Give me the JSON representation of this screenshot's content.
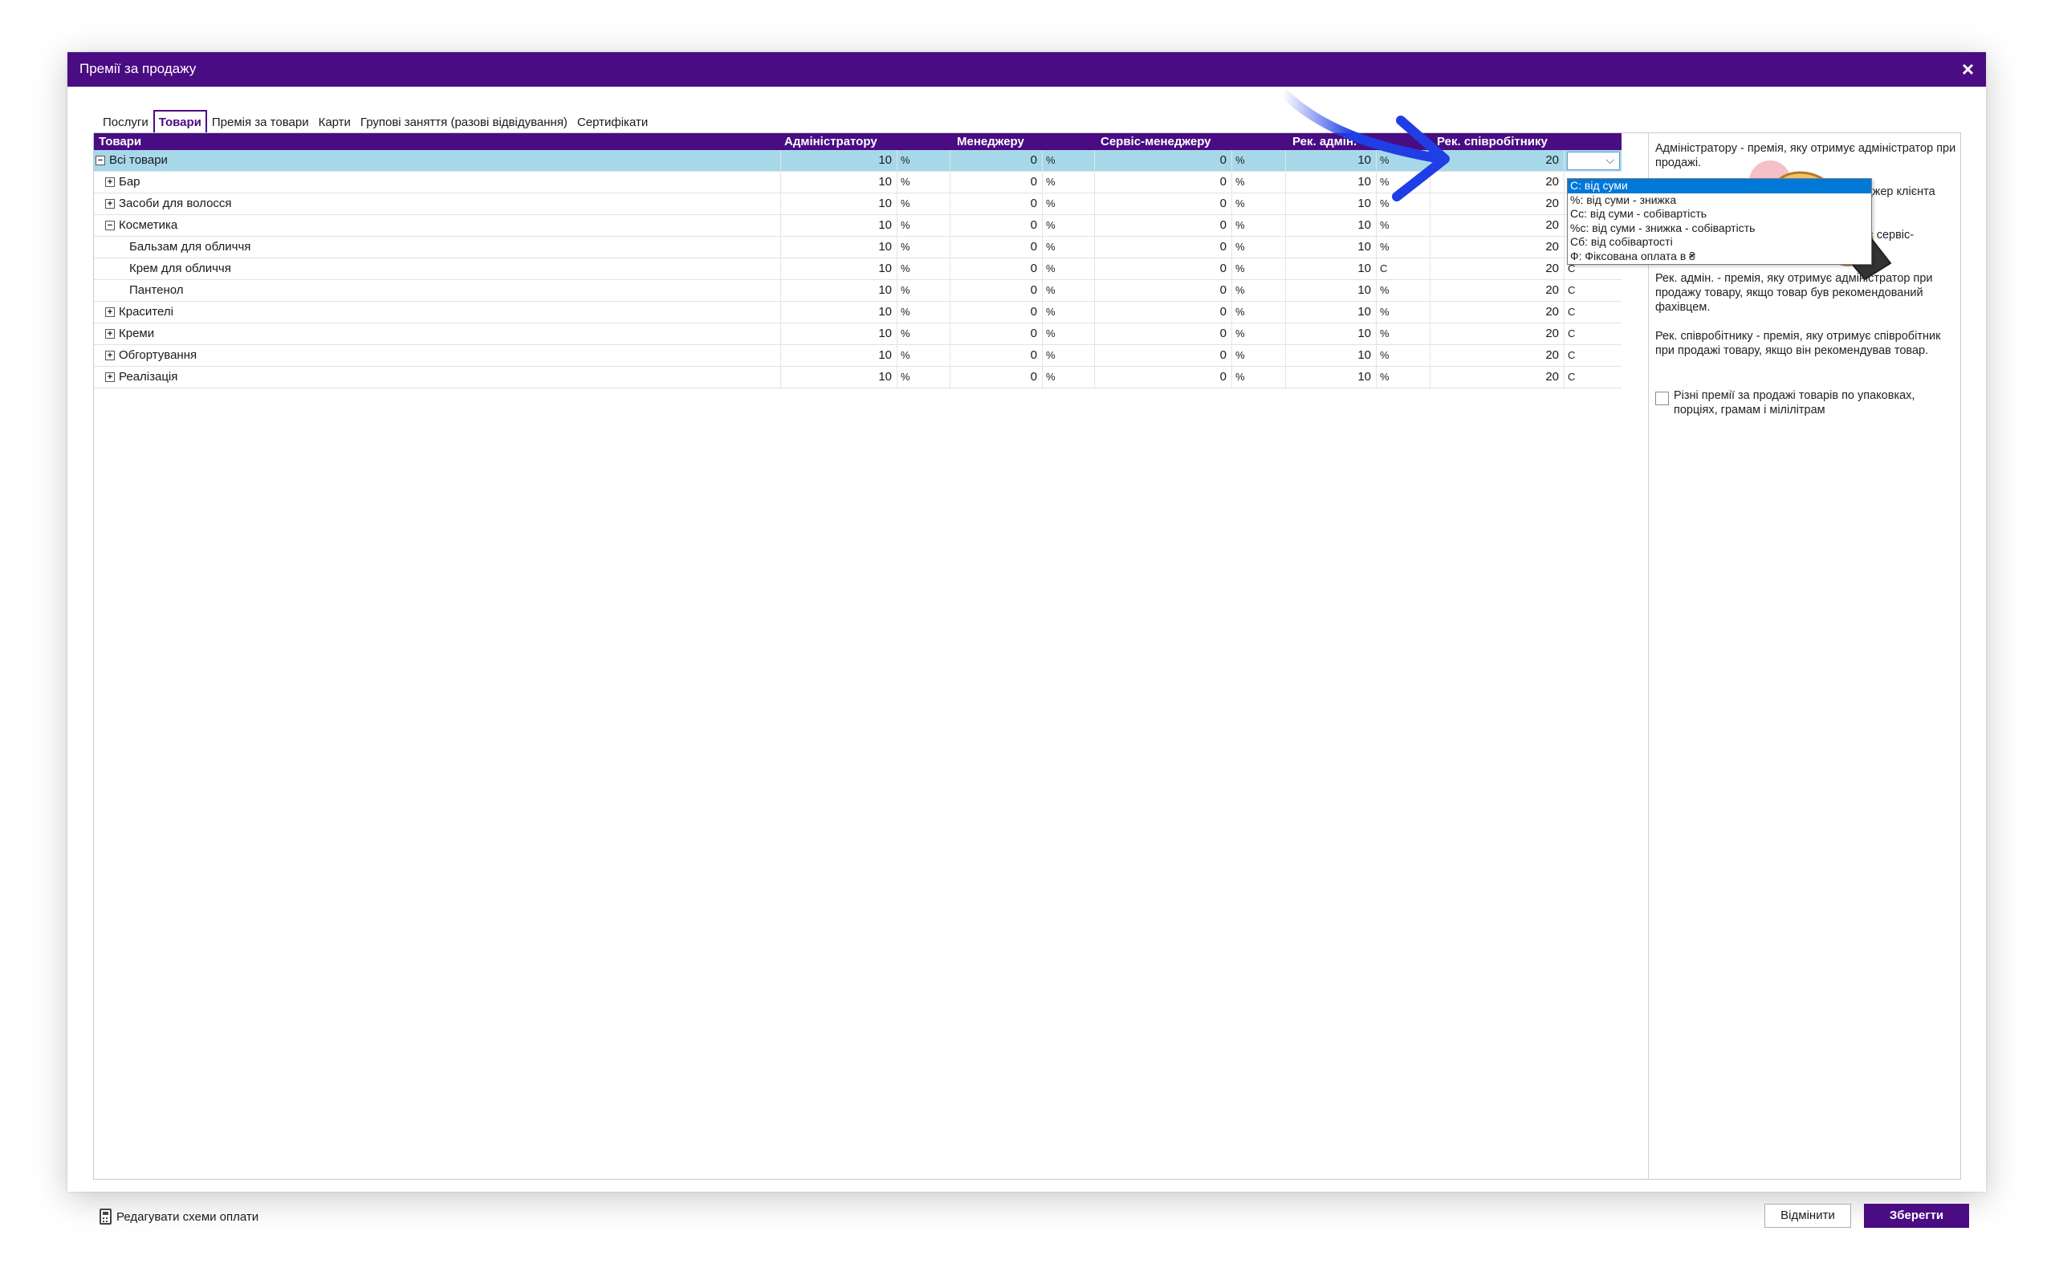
{
  "window": {
    "title": "Премії за продажу",
    "close_label": "×"
  },
  "tabs": [
    {
      "label": "Послуги",
      "active": false
    },
    {
      "label": "Товари",
      "active": true
    },
    {
      "label": "Премія за товари",
      "active": false
    },
    {
      "label": "Карти",
      "active": false
    },
    {
      "label": "Групові заняття (разові відвідування)",
      "active": false
    },
    {
      "label": "Сертифікати",
      "active": false
    }
  ],
  "grid": {
    "headers": {
      "name": "Товари",
      "admin": "Адміністратору",
      "manager": "Менеджеру",
      "service_manager": "Сервіс-менеджеру",
      "rec_admin": "Рек. адмін.",
      "rec_employee": "Рек. співробітнику"
    },
    "rows": [
      {
        "name": "Всі товари",
        "expander": "⊟",
        "admin": "10",
        "admin_u": "%",
        "manager": "0",
        "manager_u": "%",
        "service": "0",
        "service_u": "%",
        "rec_admin": "10",
        "rec_admin_u": "%",
        "rec_emp": "20",
        "rec_emp_u": ""
      },
      {
        "name": "Бар",
        "expander": "⊞",
        "admin": "10",
        "admin_u": "%",
        "manager": "0",
        "manager_u": "%",
        "service": "0",
        "service_u": "%",
        "rec_admin": "10",
        "rec_admin_u": "%",
        "rec_emp": "20",
        "rec_emp_u": ""
      },
      {
        "name": "Засоби для волосся",
        "expander": "⊞",
        "admin": "10",
        "admin_u": "%",
        "manager": "0",
        "manager_u": "%",
        "service": "0",
        "service_u": "%",
        "rec_admin": "10",
        "rec_admin_u": "%",
        "rec_emp": "20",
        "rec_emp_u": ""
      },
      {
        "name": "Косметика",
        "expander": "⊟",
        "admin": "10",
        "admin_u": "%",
        "manager": "0",
        "manager_u": "%",
        "service": "0",
        "service_u": "%",
        "rec_admin": "10",
        "rec_admin_u": "%",
        "rec_emp": "20",
        "rec_emp_u": ""
      },
      {
        "name": "Бальзам для обличчя",
        "expander": "",
        "admin": "10",
        "admin_u": "%",
        "manager": "0",
        "manager_u": "%",
        "service": "0",
        "service_u": "%",
        "rec_admin": "10",
        "rec_admin_u": "%",
        "rec_emp": "20",
        "rec_emp_u": ""
      },
      {
        "name": "Крем для обличчя",
        "expander": "",
        "admin": "10",
        "admin_u": "%",
        "manager": "0",
        "manager_u": "%",
        "service": "0",
        "service_u": "%",
        "rec_admin": "10",
        "rec_admin_u": "С",
        "rec_emp": "20",
        "rec_emp_u": "С"
      },
      {
        "name": "Пантенол",
        "expander": "",
        "admin": "10",
        "admin_u": "%",
        "manager": "0",
        "manager_u": "%",
        "service": "0",
        "service_u": "%",
        "rec_admin": "10",
        "rec_admin_u": "%",
        "rec_emp": "20",
        "rec_emp_u": "С"
      },
      {
        "name": "Красителі",
        "expander": "⊞",
        "admin": "10",
        "admin_u": "%",
        "manager": "0",
        "manager_u": "%",
        "service": "0",
        "service_u": "%",
        "rec_admin": "10",
        "rec_admin_u": "%",
        "rec_emp": "20",
        "rec_emp_u": "С"
      },
      {
        "name": "Креми",
        "expander": "⊞",
        "admin": "10",
        "admin_u": "%",
        "manager": "0",
        "manager_u": "%",
        "service": "0",
        "service_u": "%",
        "rec_admin": "10",
        "rec_admin_u": "%",
        "rec_emp": "20",
        "rec_emp_u": "С"
      },
      {
        "name": "Обгортування",
        "expander": "⊞",
        "admin": "10",
        "admin_u": "%",
        "manager": "0",
        "manager_u": "%",
        "service": "0",
        "service_u": "%",
        "rec_admin": "10",
        "rec_admin_u": "%",
        "rec_emp": "20",
        "rec_emp_u": "С"
      },
      {
        "name": "Реалізація",
        "expander": "⊞",
        "admin": "10",
        "admin_u": "%",
        "manager": "0",
        "manager_u": "%",
        "service": "0",
        "service_u": "%",
        "rec_admin": "10",
        "rec_admin_u": "%",
        "rec_emp": "20",
        "rec_emp_u": "С"
      }
    ]
  },
  "dropdown": {
    "options": [
      "С: від суми",
      "%: від суми - знижка",
      "Сс: від суми - собівартість",
      "%с: від суми - знижка - собівартість",
      "Сб: від собівартості",
      "Ф: Фіксована оплата в ₴"
    ],
    "highlighted_index": 0
  },
  "info": {
    "p1": "Адміністратору - премія, яку отримує адміністратор при продажі.",
    "p2": "Менеджеру - премія, яку отримує менеджер клієнта при продажі.",
    "p3": "Сервіс-менеджеру - премія, яку отримує сервіс-менеджер клієнта при продажу.",
    "p4": "Рек. адмін. - премія, яку отримує адміністратор при продажу товару, якщо товар був рекомендований фахівцем.",
    "p5": "Рек. співробітнику - премія, яку отримує співробітник при продажі товару, якщо він рекомендував товар.",
    "checkbox_label": "Різні премії за продажі товарів по упаковках, порціях, грамам і мілілітрам",
    "checkbox_checked": false
  },
  "footer": {
    "edit_schemes_label": "Редагувати схеми оплати",
    "cancel_label": "Відмінити",
    "save_label": "Зберегти"
  },
  "colors": {
    "brand": "#4a0c83",
    "selected_row": "#a7d8ea",
    "highlight": "#0078d7",
    "pointer_arrow": "#1f3ee6"
  }
}
